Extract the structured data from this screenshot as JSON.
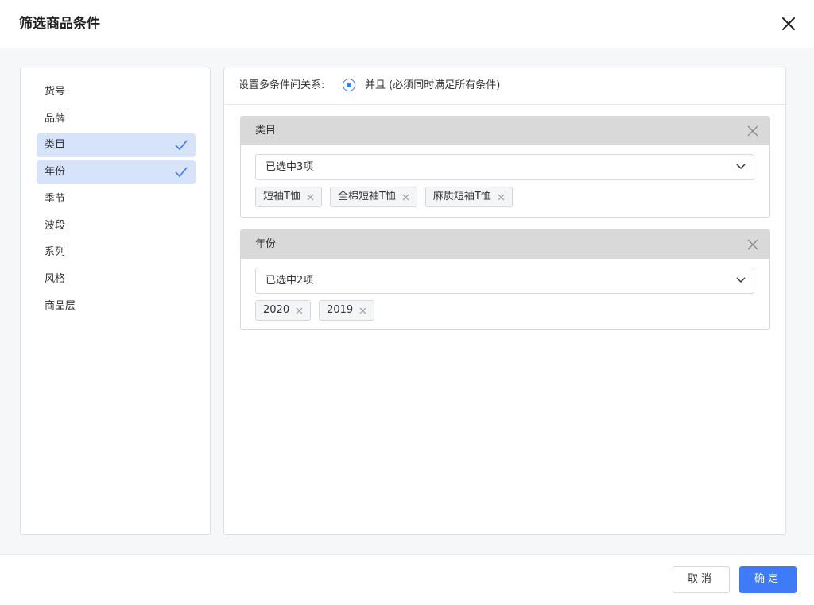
{
  "dialog": {
    "title": "筛选商品条件"
  },
  "fields": [
    {
      "label": "货号",
      "selected": false
    },
    {
      "label": "品牌",
      "selected": false
    },
    {
      "label": "类目",
      "selected": true
    },
    {
      "label": "年份",
      "selected": true
    },
    {
      "label": "季节",
      "selected": false
    },
    {
      "label": "波段",
      "selected": false
    },
    {
      "label": "系列",
      "selected": false
    },
    {
      "label": "风格",
      "selected": false
    },
    {
      "label": "商品层",
      "selected": false
    }
  ],
  "relation": {
    "label": "设置多条件间关系:",
    "option": "并且 (必须同时满足所有条件)",
    "checked": true
  },
  "conditions": [
    {
      "title": "类目",
      "summary": "已选中3项",
      "tags": [
        "短袖T恤",
        "全棉短袖T恤",
        "麻质短袖T恤"
      ]
    },
    {
      "title": "年份",
      "summary": "已选中2项",
      "tags": [
        "2020",
        "2019"
      ]
    }
  ],
  "footer": {
    "cancel_label": "取消",
    "ok_label": "确定"
  },
  "colors": {
    "accent": "#3f7bf6",
    "selected_row": "#d6e3fb",
    "condition_header": "#d9d9d9"
  }
}
